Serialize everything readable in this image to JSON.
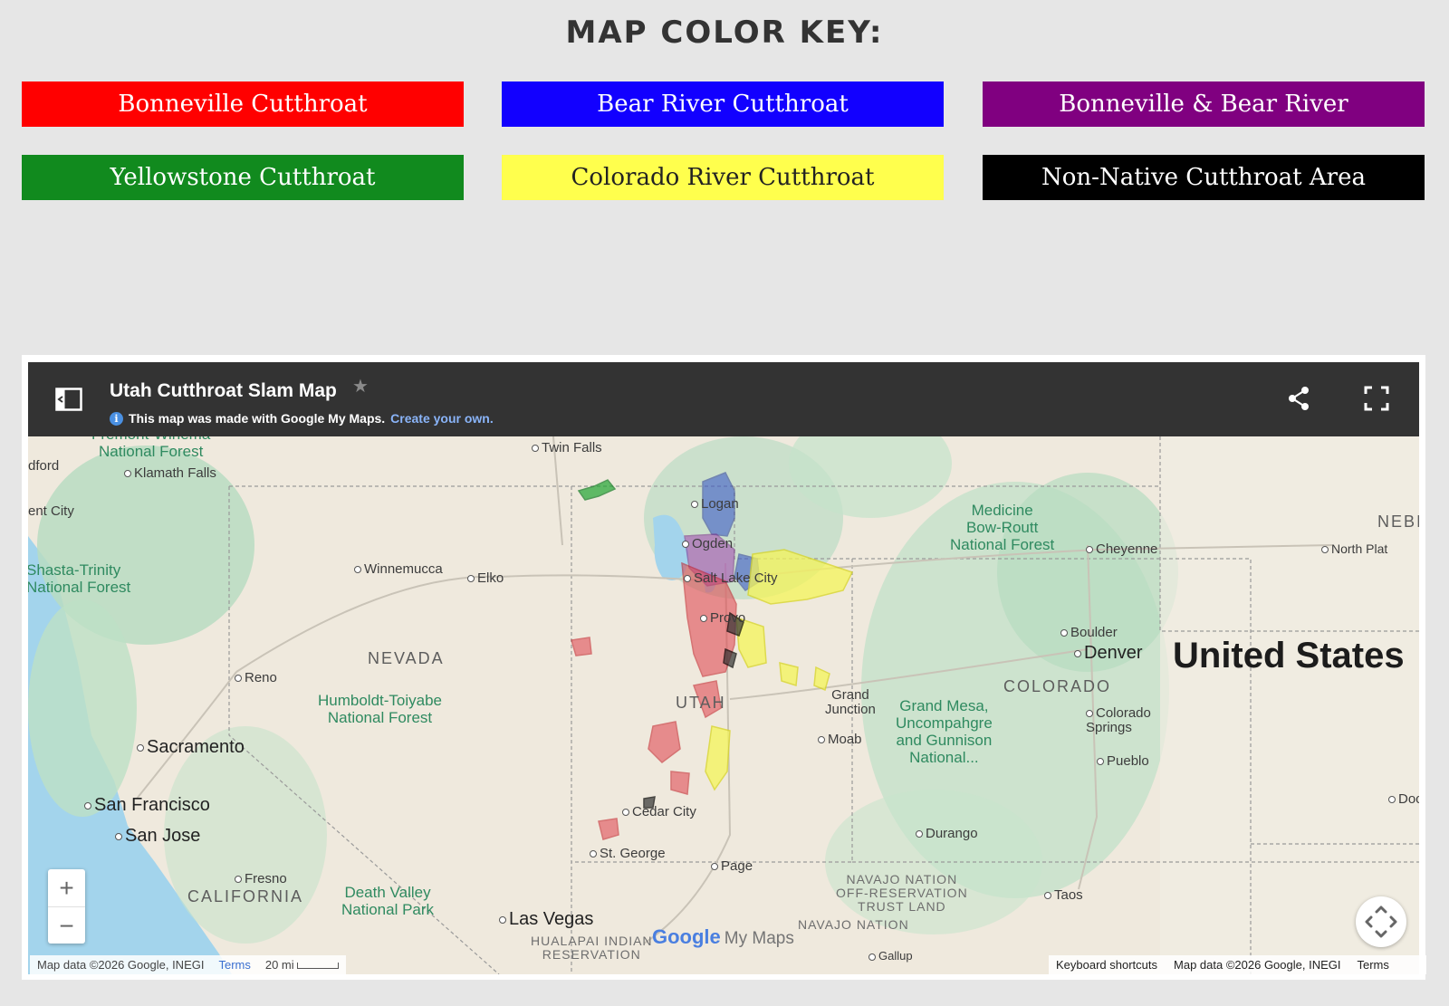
{
  "key": {
    "title": "MAP COLOR KEY:",
    "items": [
      {
        "label": "Bonneville Cutthroat",
        "color": "#ff0000",
        "text_color": "#ffffff"
      },
      {
        "label": "Bear River Cutthroat",
        "color": "#1200ff",
        "text_color": "#ffffff"
      },
      {
        "label": "Bonneville & Bear River",
        "color": "#800080",
        "text_color": "#ffffff"
      },
      {
        "label": "Yellowstone Cutthroat",
        "color": "#118a1e",
        "text_color": "#ffffff"
      },
      {
        "label": "Colorado River Cutthroat",
        "color": "#ffff4d",
        "text_color": "#222222"
      },
      {
        "label": "Non-Native Cutthroat Area",
        "color": "#000000",
        "text_color": "#ffffff"
      }
    ]
  },
  "map": {
    "title": "Utah Cutthroat Slam Map",
    "subtitle": "This map was made with Google My Maps.",
    "subtitle_link": "Create your own.",
    "labels": {
      "twin_falls": "Twin Falls",
      "fremont": "Fremont-Winema\nNational Forest",
      "medford": "dford",
      "klamath": "Klamath Falls",
      "ent_city": "ent City",
      "shasta": "Shasta-Trinity\nNational Forest",
      "winnemucca": "Winnemucca",
      "elko": "Elko",
      "nevada": "NEVADA",
      "reno": "Reno",
      "humboldt": "Humboldt-Toiyabe\nNational Forest",
      "sacramento": "Sacramento",
      "san_francisco": "San Francisco",
      "san_jose": "San Jose",
      "fresno": "Fresno",
      "california": "CALIFORNIA",
      "death_valley": "Death Valley\nNational Park",
      "las_vegas": "Las Vegas",
      "hualapai": "HUALAPAI INDIAN\nRESERVATION",
      "st_george": "St. George",
      "cedar_city": "Cedar City",
      "page": "Page",
      "navajo_off": "NAVAJO NATION\nOFF-RESERVATION\nTRUST LAND",
      "navajo": "NAVAJO NATION",
      "logan": "Logan",
      "ogden": "Ogden",
      "slc": "Salt Lake City",
      "provo": "Provo",
      "utah": "UTAH",
      "grand_junction": "Grand\nJunction",
      "moab": "Moab",
      "grand_mesa": "Grand Mesa,\nUncompahgre\nand Gunnison\nNational...",
      "durango": "Durango",
      "taos": "Taos",
      "medicine_bow": "Medicine\nBow-Routt\nNational Forest",
      "cheyenne": "Cheyenne",
      "north_platte": "North Plat",
      "nebr": "NEBI",
      "boulder": "Boulder",
      "denver": "Denver",
      "colorado": "COLORADO",
      "colorado_springs": "Colorado\nSprings",
      "pueblo": "Pueblo",
      "dodge": "Doc",
      "us": "United States",
      "gallup": "Gallup"
    },
    "footer": {
      "left_attr": "Map data ©2026 Google, INEGI",
      "left_terms": "Terms",
      "scale": "20 mi",
      "shortcuts": "Keyboard shortcuts",
      "right_attr": "Map data ©2026 Google, INEGI",
      "right_terms": "Terms"
    },
    "logo": "Google",
    "logo_suffix": "My Maps",
    "zoom_in": "+",
    "zoom_out": "−"
  },
  "icons": {
    "sidebar_toggle": "sidebar-toggle-icon",
    "star": "star-icon",
    "info": "info-icon",
    "share": "share-icon",
    "fullscreen": "fullscreen-icon",
    "pan": "pan-arrows-icon"
  }
}
